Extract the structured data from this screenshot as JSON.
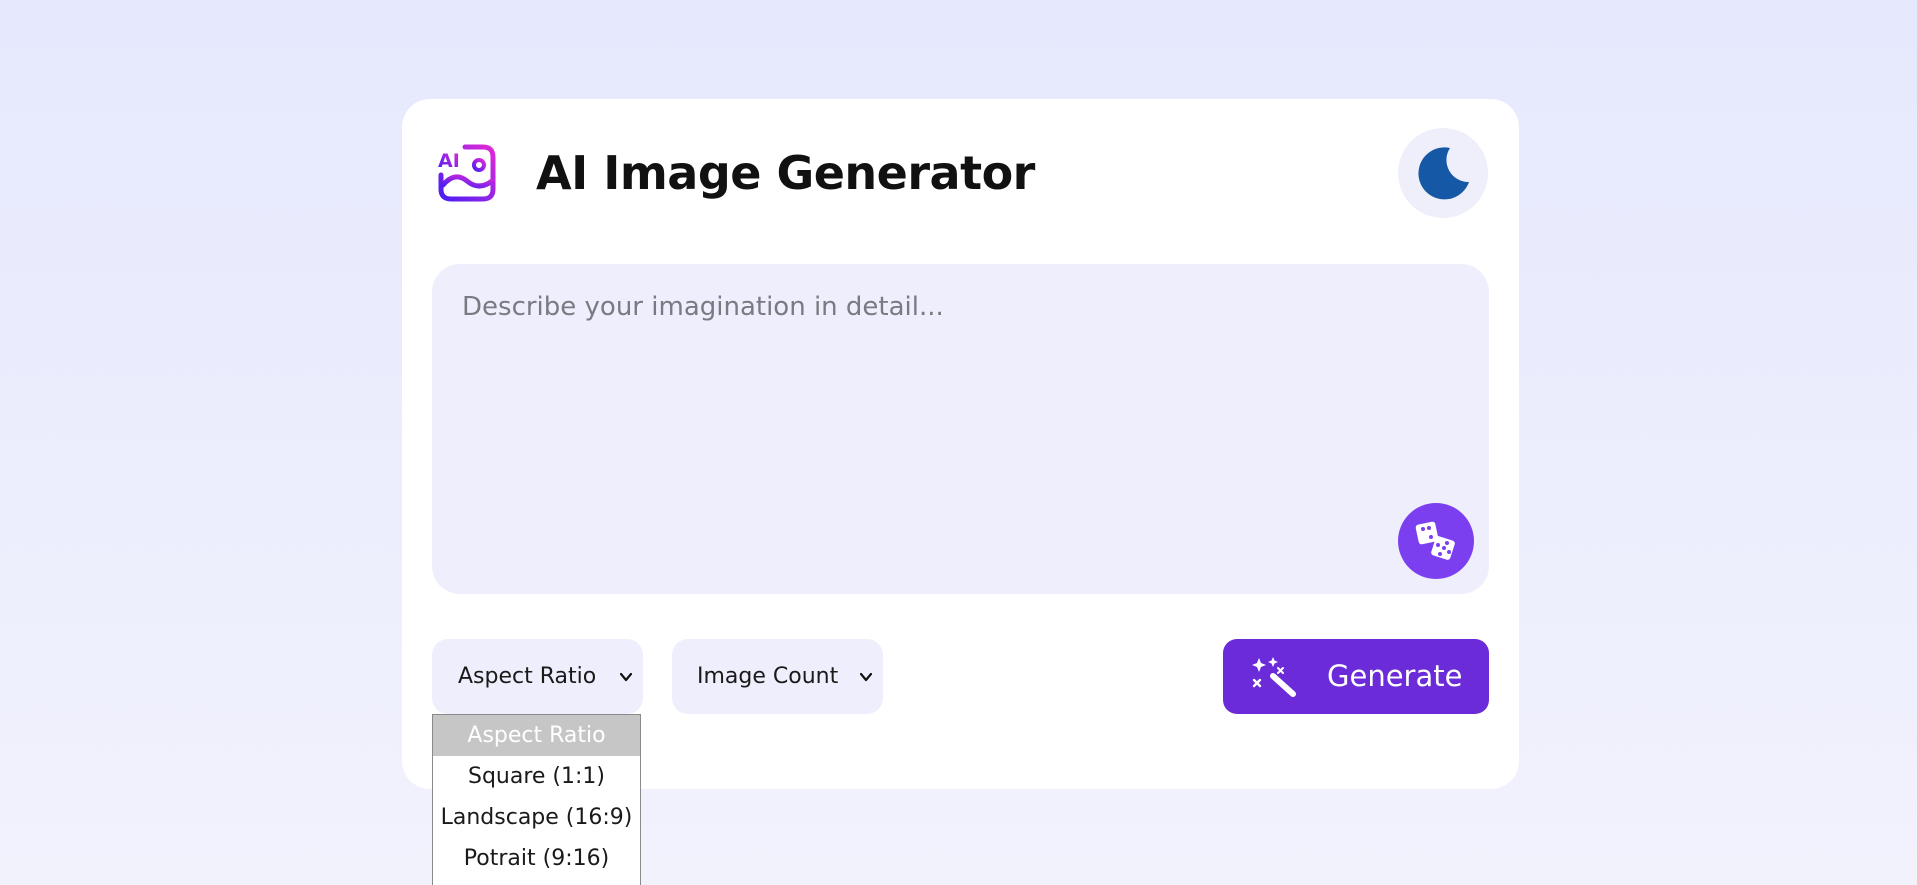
{
  "app": {
    "title": "AI Image Generator",
    "logo_icon": "ai-image-logo-icon",
    "theme_toggle_icon": "moon-icon"
  },
  "prompt": {
    "placeholder": "Describe your imagination in detail...",
    "value": "",
    "random_button_icon": "dice-icon"
  },
  "controls": {
    "aspect_ratio": {
      "selected_label": "Aspect Ratio",
      "options": [
        "Aspect Ratio",
        "Square (1:1)",
        "Landscape (16:9)",
        "Potrait (9:16)"
      ]
    },
    "image_count": {
      "selected_label": "Image Count"
    },
    "generate": {
      "label": "Generate",
      "icon": "magic-wand-icon"
    }
  },
  "colors": {
    "accent": "#6b2bd9",
    "dice_bg": "#7b3ff0",
    "moon": "#1558a5",
    "input_bg": "#efeefc"
  }
}
